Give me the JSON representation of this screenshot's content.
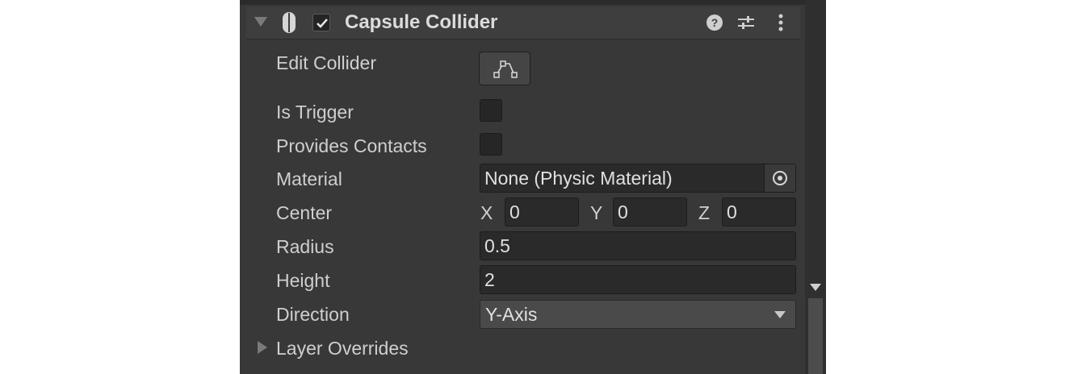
{
  "component": {
    "title": "Capsule Collider",
    "enabled": true,
    "icon": "capsule-icon"
  },
  "header_icons": {
    "help": "help-icon",
    "presets": "presets-icon",
    "more": "more-icon"
  },
  "properties": {
    "edit_collider": {
      "label": "Edit Collider",
      "icon": "edit-collider-icon"
    },
    "is_trigger": {
      "label": "Is Trigger",
      "checked": false
    },
    "provides_contacts": {
      "label": "Provides Contacts",
      "checked": false
    },
    "material": {
      "label": "Material",
      "value": "None (Physic Material)"
    },
    "center": {
      "label": "Center",
      "x_label": "X",
      "x": "0",
      "y_label": "Y",
      "y": "0",
      "z_label": "Z",
      "z": "0"
    },
    "radius": {
      "label": "Radius",
      "value": "0.5"
    },
    "height": {
      "label": "Height",
      "value": "2"
    },
    "direction": {
      "label": "Direction",
      "value": "Y-Axis"
    },
    "layer_overrides": {
      "label": "Layer Overrides"
    }
  },
  "colors": {
    "panel_bg": "#383838",
    "header_bg": "#3e3e3e",
    "field_bg": "#2a2a2a",
    "text": "#cfcfcf"
  }
}
